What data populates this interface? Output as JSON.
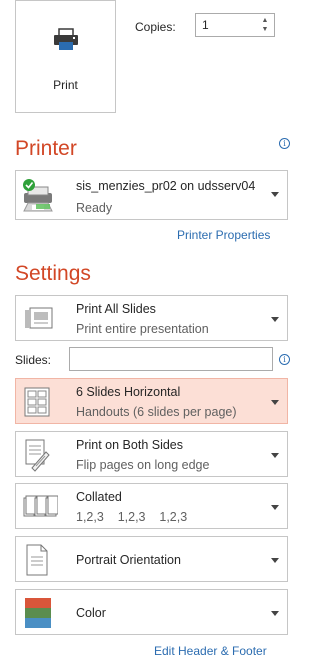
{
  "print": {
    "label": "Print"
  },
  "copies": {
    "label": "Copies:",
    "value": "1"
  },
  "printer": {
    "section_title": "Printer",
    "name": "sis_menzies_pr02 on udsserv04",
    "status": "Ready",
    "properties_link": "Printer Properties"
  },
  "settings": {
    "section_title": "Settings",
    "slides_label": "Slides:",
    "slides_value": "",
    "items": [
      {
        "main": "Print All Slides",
        "sub": "Print entire presentation",
        "icon": "slides-icon"
      },
      {
        "main": "6 Slides Horizontal",
        "sub": "Handouts (6 slides per page)",
        "icon": "six-slides-grid-icon"
      },
      {
        "main": "Print on Both Sides",
        "sub": "Flip pages on long edge",
        "icon": "duplex-icon"
      },
      {
        "main": "Collated",
        "sub": "1,2,3    1,2,3    1,2,3",
        "icon": "collated-icon"
      },
      {
        "main": "Portrait Orientation",
        "icon": "portrait-page-icon"
      },
      {
        "main": "Color",
        "icon": "color-swatch-icon"
      }
    ],
    "edit_header_footer": "Edit Header & Footer"
  },
  "colors": {
    "accent": "#d24726",
    "link": "#2b6cb0",
    "highlight": "#fcdfd6"
  }
}
